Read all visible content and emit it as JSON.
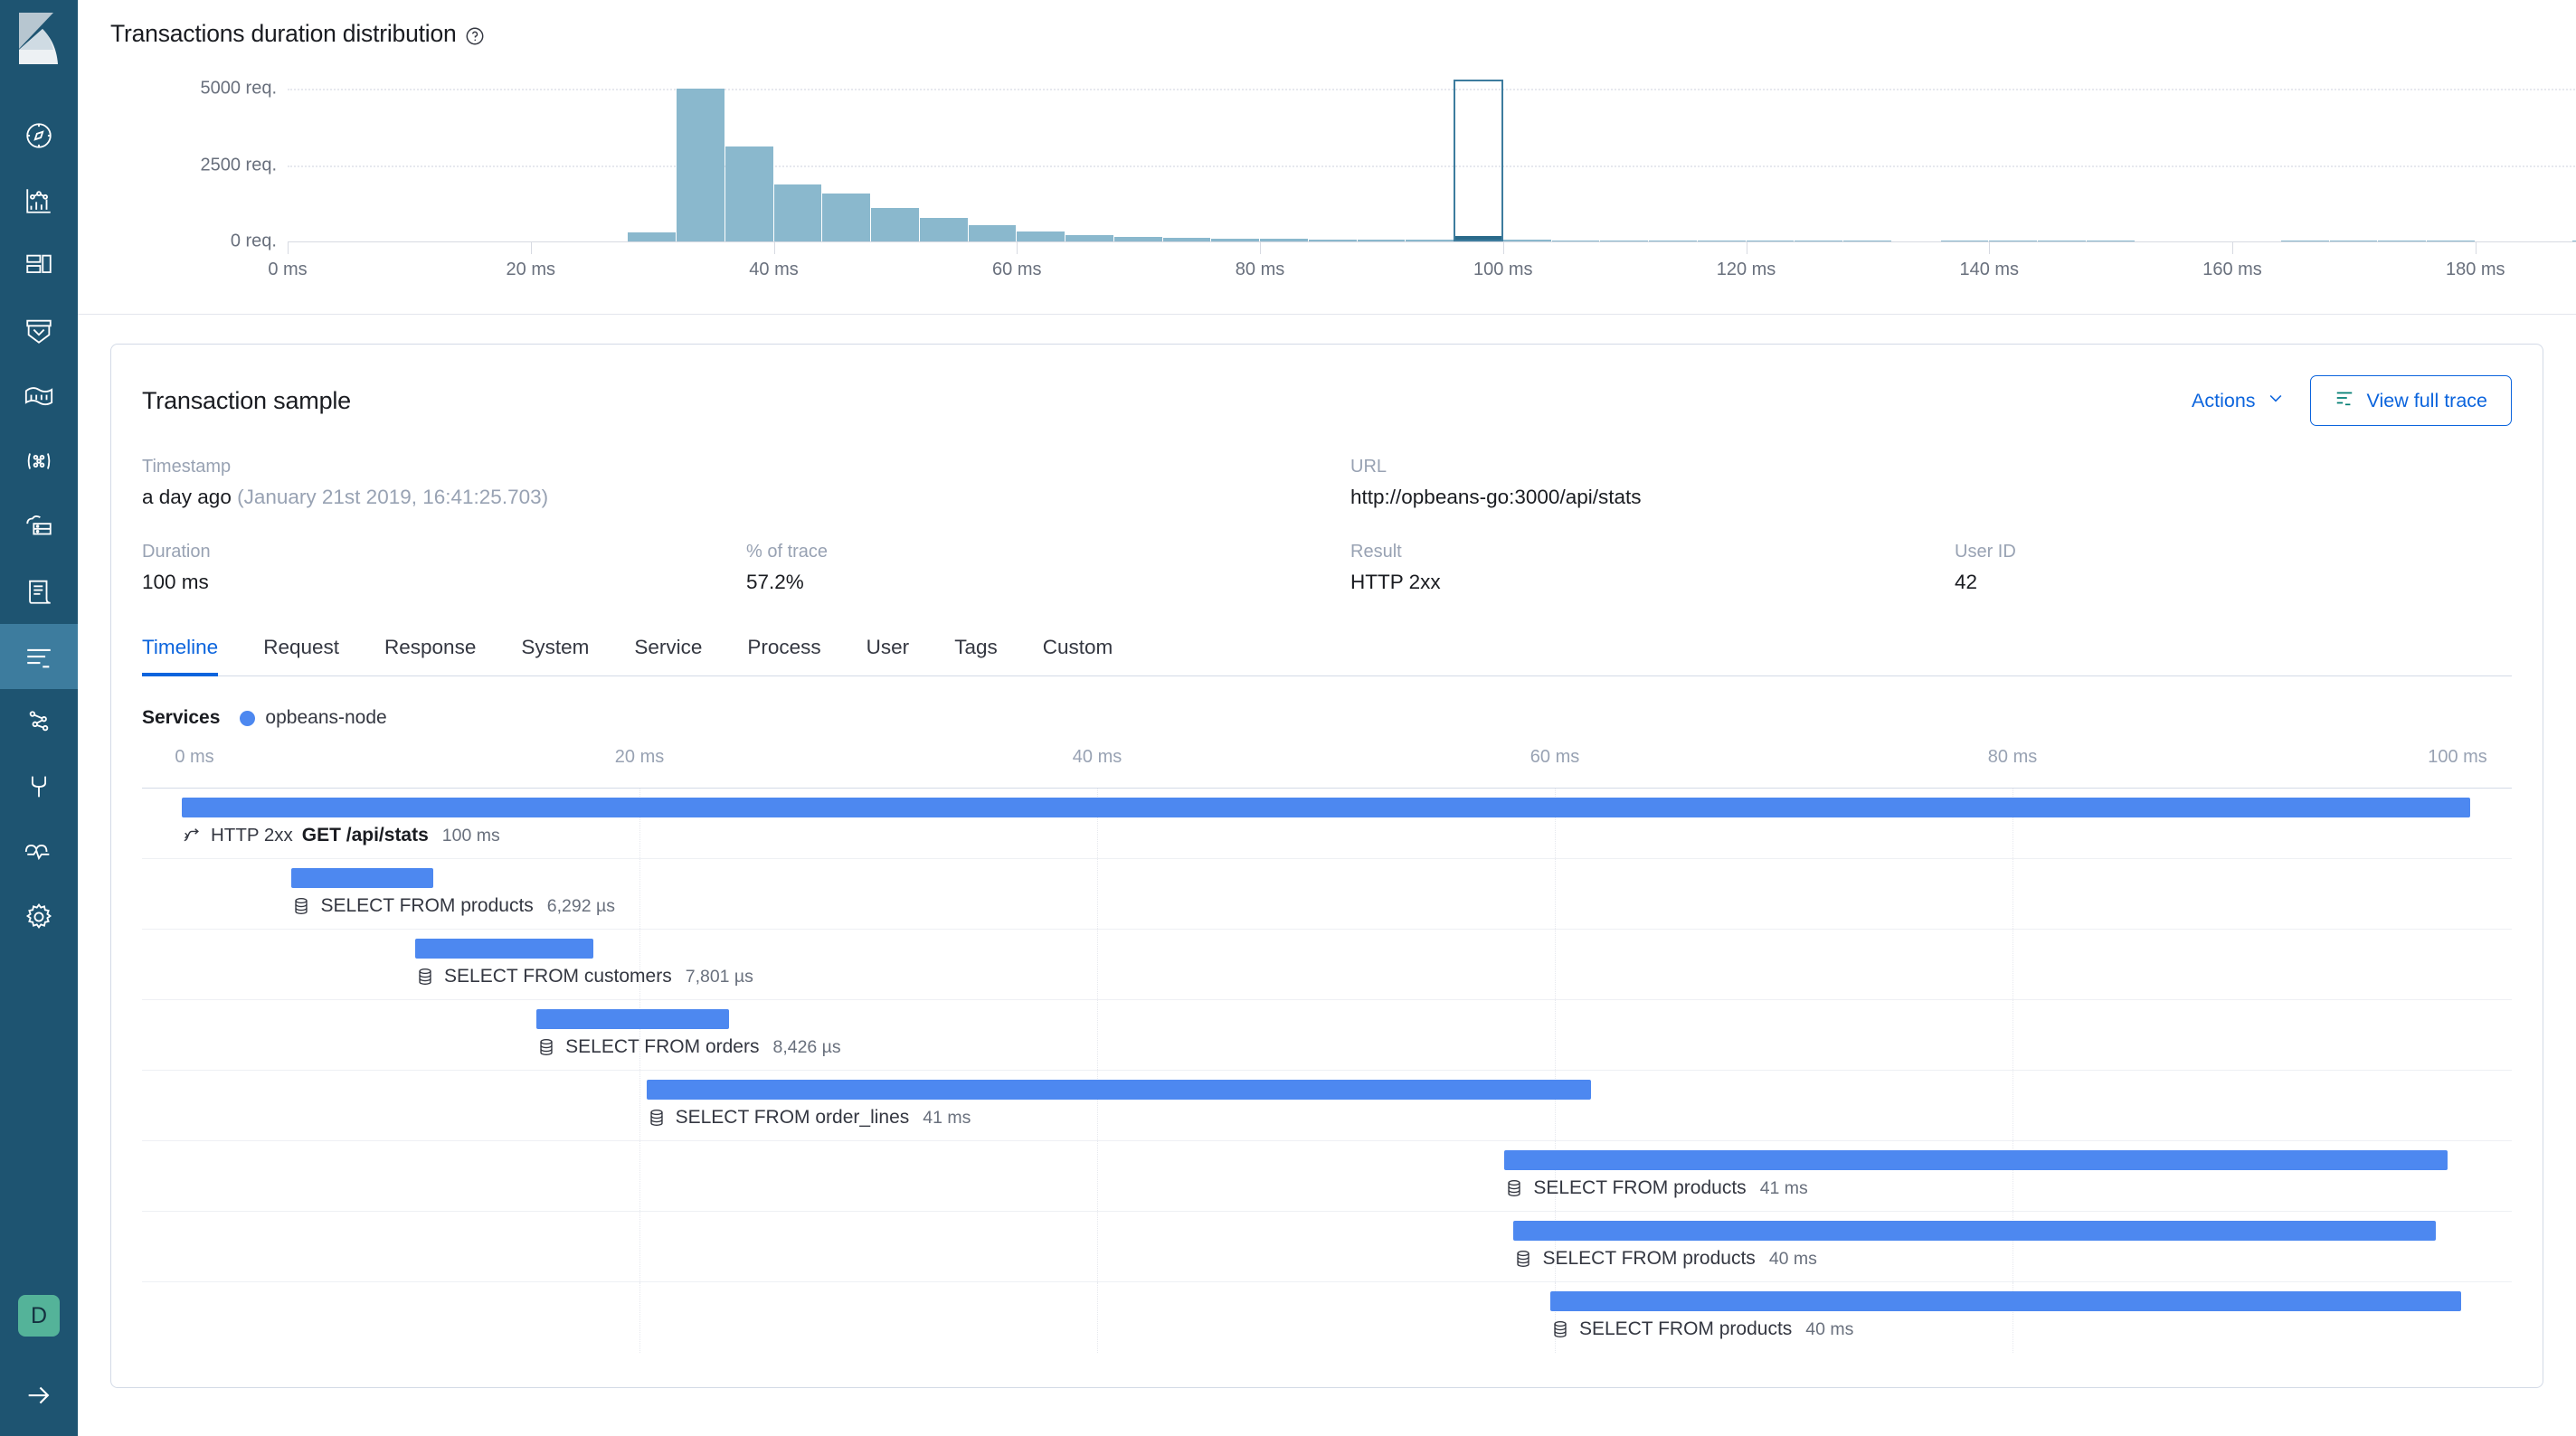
{
  "sidebar": {
    "logo_name": "kibana-logo",
    "items": [
      {
        "name": "discover-icon",
        "label": "Discover"
      },
      {
        "name": "visualize-icon",
        "label": "Visualize"
      },
      {
        "name": "dashboard-icon",
        "label": "Dashboard"
      },
      {
        "name": "canvas-icon",
        "label": "Canvas"
      },
      {
        "name": "maps-icon",
        "label": "Maps"
      },
      {
        "name": "machine-learning-icon",
        "label": "Machine Learning"
      },
      {
        "name": "infrastructure-icon",
        "label": "Infrastructure"
      },
      {
        "name": "logs-icon",
        "label": "Logs"
      },
      {
        "name": "apm-icon",
        "label": "APM",
        "active": true
      },
      {
        "name": "uptime-icon",
        "label": "Uptime"
      },
      {
        "name": "dev-tools-icon",
        "label": "Dev Tools"
      },
      {
        "name": "monitoring-icon",
        "label": "Monitoring"
      },
      {
        "name": "management-icon",
        "label": "Management"
      }
    ],
    "avatar_initial": "D",
    "collapse_label": "collapse-arrow-icon"
  },
  "histogram": {
    "title": "Transactions duration distribution",
    "help_icon": "help-circle-icon"
  },
  "chart_data": {
    "type": "bar",
    "title": "Transactions duration distribution",
    "xlabel": "",
    "ylabel": "req.",
    "ylim": [
      0,
      5400
    ],
    "xlim": [
      0,
      192
    ],
    "grid": true,
    "legend": null,
    "ytick_labels": [
      "0 req.",
      "2500 req.",
      "5000 req."
    ],
    "ytick_values": [
      0,
      2500,
      5000
    ],
    "xtick_labels": [
      "0 ms",
      "20 ms",
      "40 ms",
      "60 ms",
      "80 ms",
      "100 ms",
      "120 ms",
      "140 ms",
      "160 ms",
      "180 ms"
    ],
    "xtick_values": [
      0,
      20,
      40,
      60,
      80,
      100,
      120,
      140,
      160,
      180
    ],
    "bin_width_ms": 4,
    "bin_starts": [
      28,
      32,
      36,
      40,
      44,
      48,
      52,
      56,
      60,
      64,
      68,
      72,
      76,
      80,
      84,
      88,
      92,
      96,
      100,
      104,
      108,
      112,
      116,
      120,
      124,
      128,
      136,
      140,
      144,
      148,
      164,
      168,
      172,
      176,
      188
    ],
    "values": [
      290,
      5020,
      3120,
      1880,
      1560,
      1100,
      760,
      520,
      330,
      215,
      150,
      120,
      95,
      80,
      70,
      62,
      55,
      190,
      48,
      42,
      40,
      38,
      36,
      34,
      32,
      30,
      28,
      27,
      26,
      25,
      22,
      21,
      20,
      19,
      18
    ],
    "selected_bin_start": 96,
    "selected_bin_label": "100 ms",
    "selected_bin_value": 190,
    "bar_color": "#8ab8cd",
    "selected_fill_color": "#2a6a8a",
    "selection_border_color": "#3d7c9e"
  },
  "sample": {
    "title": "Transaction sample",
    "actions_label": "Actions",
    "chevron_icon": "chevron-down-icon",
    "view_trace_label": "View full trace",
    "view_trace_icon": "trace-lines-icon",
    "fields": {
      "timestamp_label": "Timestamp",
      "timestamp_relative": "a day ago",
      "timestamp_absolute": "(January 21st 2019, 16:41:25.703)",
      "url_label": "URL",
      "url_value": "http://opbeans-go:3000/api/stats",
      "duration_label": "Duration",
      "duration_value": "100 ms",
      "pct_label": "% of trace",
      "pct_value": "57.2%",
      "result_label": "Result",
      "result_value": "HTTP 2xx",
      "userid_label": "User ID",
      "userid_value": "42"
    },
    "tabs": [
      {
        "label": "Timeline",
        "active": true
      },
      {
        "label": "Request",
        "active": false
      },
      {
        "label": "Response",
        "active": false
      },
      {
        "label": "System",
        "active": false
      },
      {
        "label": "Service",
        "active": false
      },
      {
        "label": "Process",
        "active": false
      },
      {
        "label": "User",
        "active": false
      },
      {
        "label": "Tags",
        "active": false
      },
      {
        "label": "Custom",
        "active": false
      }
    ]
  },
  "timeline": {
    "services_label": "Services",
    "services": [
      {
        "name": "opbeans-node",
        "color": "#4d88f0"
      }
    ],
    "axis_ticks": [
      {
        "label": "0 ms",
        "value": 0
      },
      {
        "label": "20 ms",
        "value": 20
      },
      {
        "label": "40 ms",
        "value": 40
      },
      {
        "label": "60 ms",
        "value": 60
      },
      {
        "label": "80 ms",
        "value": 80
      },
      {
        "label": "100 ms",
        "value": 100
      }
    ],
    "axis_max": 100,
    "spans": [
      {
        "type": "transaction",
        "icon": "transaction-icon",
        "http": "HTTP 2xx",
        "name": "GET /api/stats",
        "duration": "100 ms",
        "start_pct": 0.0,
        "width_pct": 100.0,
        "bold": true
      },
      {
        "type": "db",
        "icon": "database-icon",
        "http": "",
        "name": "SELECT FROM products",
        "duration": "6,292 µs",
        "start_pct": 4.8,
        "width_pct": 6.2,
        "bold": false
      },
      {
        "type": "db",
        "icon": "database-icon",
        "http": "",
        "name": "SELECT FROM customers",
        "duration": "7,801 µs",
        "start_pct": 10.2,
        "width_pct": 7.8,
        "bold": false
      },
      {
        "type": "db",
        "icon": "database-icon",
        "http": "",
        "name": "SELECT FROM orders",
        "duration": "8,426 µs",
        "start_pct": 15.5,
        "width_pct": 8.4,
        "bold": false
      },
      {
        "type": "db",
        "icon": "database-icon",
        "http": "",
        "name": "SELECT FROM order_lines",
        "duration": "41 ms",
        "start_pct": 20.3,
        "width_pct": 41.3,
        "bold": false
      },
      {
        "type": "db",
        "icon": "database-icon",
        "http": "",
        "name": "SELECT FROM products",
        "duration": "41 ms",
        "start_pct": 57.8,
        "width_pct": 41.2,
        "bold": false
      },
      {
        "type": "db",
        "icon": "database-icon",
        "http": "",
        "name": "SELECT FROM products",
        "duration": "40 ms",
        "start_pct": 58.2,
        "width_pct": 40.3,
        "bold": false
      },
      {
        "type": "db",
        "icon": "database-icon",
        "http": "",
        "name": "SELECT FROM products",
        "duration": "40 ms",
        "start_pct": 59.8,
        "width_pct": 39.8,
        "bold": false
      }
    ]
  }
}
